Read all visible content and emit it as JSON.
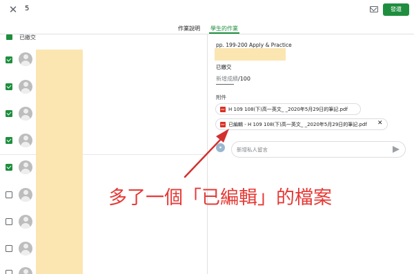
{
  "header": {
    "close_icon": "close-icon",
    "count": "5",
    "mail_icon": "mail-icon",
    "return_button": "發還"
  },
  "tabs": [
    {
      "label": "作業說明",
      "active": false
    },
    {
      "label": "學生的作業",
      "active": true
    }
  ],
  "student_list": {
    "section_label": "已繳交",
    "rows": [
      {
        "checked": true
      },
      {
        "checked": true
      },
      {
        "checked": true
      },
      {
        "checked": true
      },
      {
        "checked": true
      },
      {
        "checked": false
      },
      {
        "checked": false
      },
      {
        "checked": false
      },
      {
        "checked": false
      }
    ]
  },
  "detail": {
    "pages_text": "pp. 199-200 Apply & Practice",
    "status": "已繳交",
    "grade_placeholder": "新增成績",
    "grade_max": "/100",
    "attachments_label": "附件",
    "attachments": [
      {
        "name": "H 109 108(下)高一英文_        _2020年5月29日的筆記.pdf",
        "icon": "pdf-icon"
      },
      {
        "name": "已編輯 - H 109 108(下)高一英文_        _2020年5月29日的筆記.pdf",
        "icon": "pdf-icon",
        "removable": true
      }
    ],
    "remove_icon": "✕",
    "comment_placeholder": "新增私人留言",
    "send_icon": "send-icon"
  },
  "annotation": {
    "caption": "多了一個「已編輯」的檔案",
    "color": "#e53935"
  },
  "colors": {
    "accent": "#1e8e3e",
    "redaction": "#fbe5b1"
  }
}
